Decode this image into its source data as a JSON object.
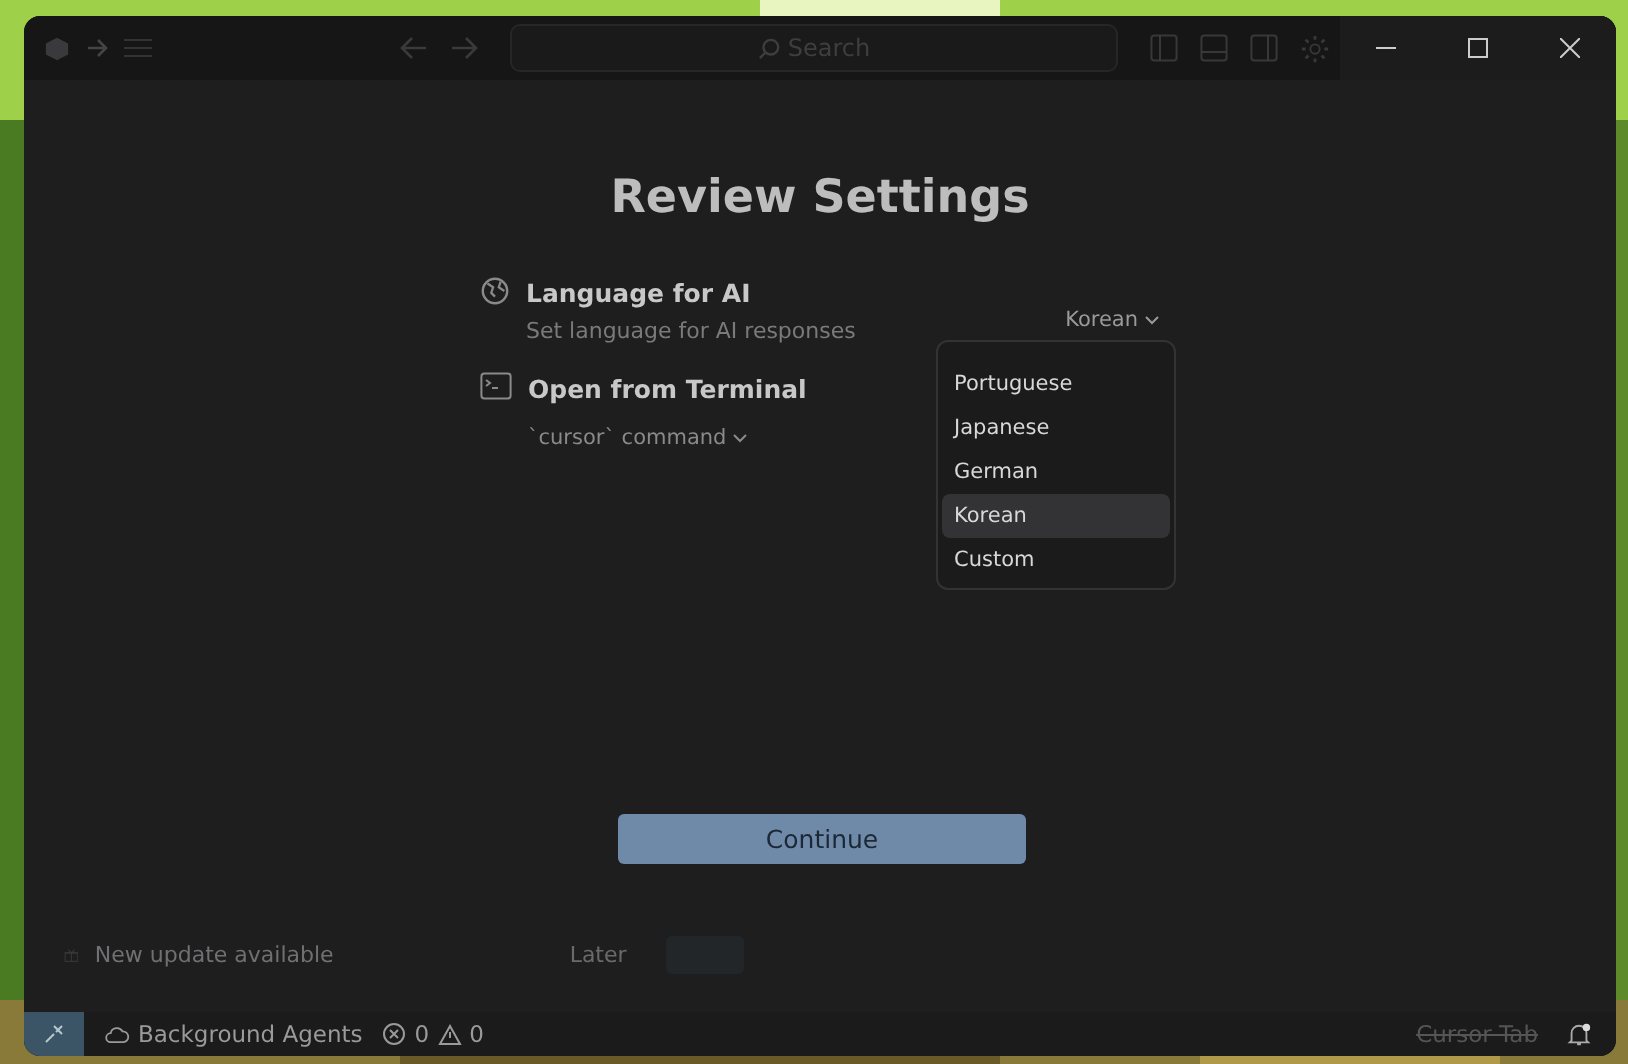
{
  "title_bar": {
    "search": {
      "placeholder": "Search"
    }
  },
  "dialog": {
    "title": "Review Settings",
    "settings": [
      {
        "kind": "language",
        "title": "Language for AI",
        "description": "Set language for AI responses",
        "value": "Korean",
        "expanded": true
      },
      {
        "kind": "terminal",
        "title": "Open from Terminal",
        "value": "`cursor` command",
        "expanded": false
      }
    ],
    "language_options": [
      {
        "label": "Portuguese",
        "selected": false
      },
      {
        "label": "Japanese",
        "selected": false
      },
      {
        "label": "German",
        "selected": false
      },
      {
        "label": "Korean",
        "selected": true
      },
      {
        "label": "Custom",
        "selected": false
      }
    ],
    "continue_button": "Continue"
  },
  "notification": {
    "message": "New update available",
    "later": "Later"
  },
  "status_bar": {
    "agents": "Background Agents",
    "errors": "0",
    "warnings": "0",
    "cursor_tab": "Cursor Tab"
  }
}
